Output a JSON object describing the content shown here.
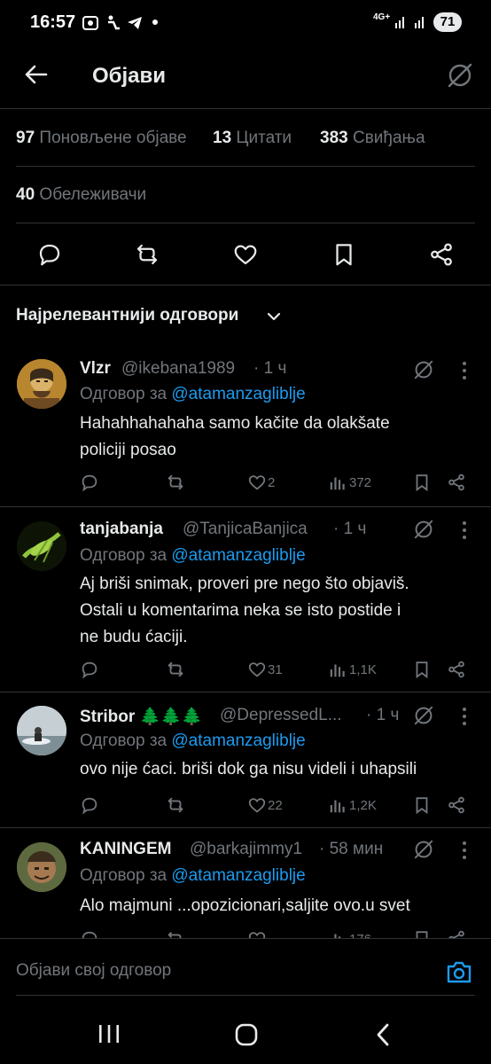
{
  "status_bar": {
    "time": "16:57",
    "network": "4G+",
    "battery": "71"
  },
  "header": {
    "title": "Објави"
  },
  "stats": {
    "reposts_count": "97",
    "reposts_label": "Поновљене објаве",
    "quotes_count": "13",
    "quotes_label": "Цитати",
    "likes_count": "383",
    "likes_label": "Свиђања",
    "bookmarks_count": "40",
    "bookmarks_label": "Обележивачи"
  },
  "sort": {
    "label": "Најрелевантнији одговори"
  },
  "replies": [
    {
      "name": "Vlzr",
      "handle": "@ikebana1989",
      "time": "· 1 ч",
      "reply_prefix": "Одговор за",
      "reply_to": "@atamanzagliblje",
      "text_lines": [
        "Hahahhahahaha samo kačite da olakšate",
        "policiji posao"
      ],
      "comments": "",
      "reposts": "",
      "likes": "2",
      "views": "372"
    },
    {
      "name": "tanjabanja",
      "handle": "@TanjicaBanjica",
      "time": "· 1 ч",
      "reply_prefix": "Одговор за",
      "reply_to": "@atamanzagliblje",
      "text_lines": [
        "Aj briši snimak, proveri pre nego što objaviš.",
        "Ostali u komentarima neka se isto postide i",
        "ne budu ćaciji."
      ],
      "comments": "",
      "reposts": "",
      "likes": "31",
      "views": "1,1K"
    },
    {
      "name": "Stribor 🌲🌲🌲",
      "handle": "@DepressedL...",
      "time": "· 1 ч",
      "reply_prefix": "Одговор за",
      "reply_to": "@atamanzagliblje",
      "text_lines": [
        "ovo nije ćaci. briši dok ga nisu videli i uhapsili"
      ],
      "comments": "",
      "reposts": "",
      "likes": "22",
      "views": "1,2K"
    },
    {
      "name": "KANINGEM",
      "handle": "@barkajimmy1",
      "time": "· 58 мин",
      "reply_prefix": "Одговор за",
      "reply_to": "@atamanzagliblje",
      "text_lines": [
        "Alo majmuni ...opozicionari,saljite ovo.u svet"
      ],
      "comments": "",
      "reposts": "",
      "likes": "",
      "views": "176"
    }
  ],
  "compose": {
    "placeholder": "Објави свој одговор"
  },
  "colors": {
    "background": "#000000",
    "text": "#e7e9ea",
    "muted": "#71767b",
    "accent": "#1d9bf0",
    "divider": "#2f3336"
  }
}
